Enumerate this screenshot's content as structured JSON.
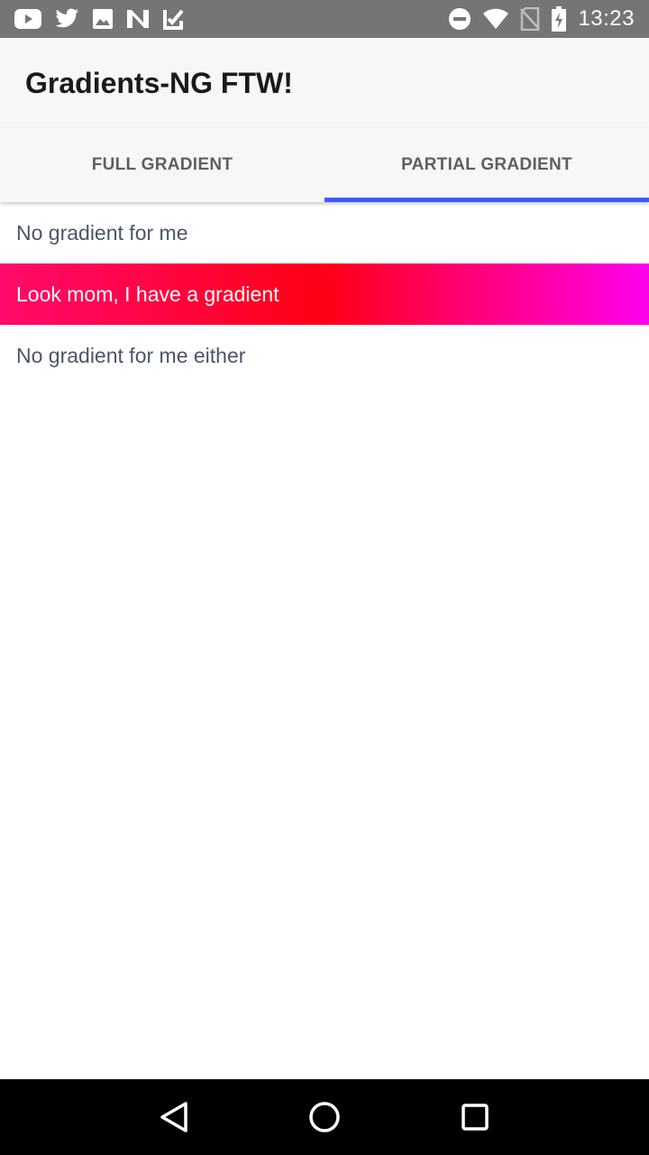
{
  "status_bar": {
    "time": "13:23",
    "left_icons": [
      "youtube-icon",
      "twitter-icon",
      "image-icon",
      "n-app-icon",
      "check-app-icon"
    ],
    "right_icons": [
      "do-not-disturb-icon",
      "wifi-icon",
      "no-sim-icon",
      "battery-charging-icon"
    ]
  },
  "app_bar": {
    "title": "Gradients-NG FTW!"
  },
  "tabs": [
    {
      "label": "FULL GRADIENT",
      "selected": false
    },
    {
      "label": "PARTIAL GRADIENT",
      "selected": true
    }
  ],
  "list": {
    "items": [
      {
        "label": "No gradient for me",
        "has_gradient": false
      },
      {
        "label": "Look mom, I have a gradient",
        "has_gradient": true
      },
      {
        "label": "No gradient for me either",
        "has_gradient": false
      }
    ]
  },
  "colors": {
    "tab_indicator": "#3d5afe",
    "gradient_start": "#ff0a6c",
    "gradient_mid": "#ff0016",
    "gradient_end": "#ff00ee",
    "status_bar_bg": "#757575",
    "app_bar_bg": "#f7f7f7"
  },
  "nav_bar": {
    "buttons": [
      "back-icon",
      "home-icon",
      "recents-icon"
    ]
  }
}
